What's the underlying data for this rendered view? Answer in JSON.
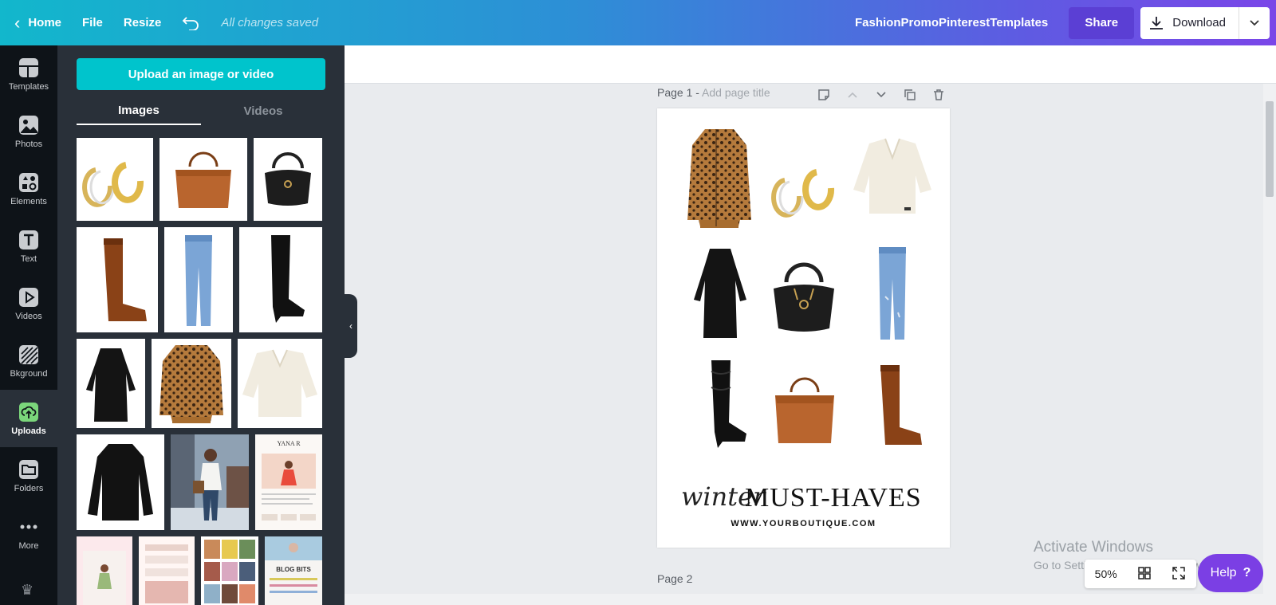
{
  "topbar": {
    "home": "Home",
    "file": "File",
    "resize": "Resize",
    "saved_status": "All changes saved",
    "doc_title": "FashionPromoPinterestTemplates",
    "share": "Share",
    "download": "Download"
  },
  "rail": {
    "items": [
      {
        "label": "Templates",
        "icon": "templates-icon"
      },
      {
        "label": "Photos",
        "icon": "photos-icon"
      },
      {
        "label": "Elements",
        "icon": "elements-icon"
      },
      {
        "label": "Text",
        "icon": "text-icon"
      },
      {
        "label": "Videos",
        "icon": "videos-icon"
      },
      {
        "label": "Bkground",
        "icon": "background-icon"
      },
      {
        "label": "Uploads",
        "icon": "uploads-icon",
        "active": true
      },
      {
        "label": "Folders",
        "icon": "folders-icon"
      },
      {
        "label": "More",
        "icon": "more-icon"
      }
    ]
  },
  "panel": {
    "upload_button": "Upload an image or video",
    "tabs": [
      {
        "label": "Images",
        "active": true
      },
      {
        "label": "Videos",
        "active": false
      }
    ],
    "thumbnail_subjects": [
      "gold hoop earrings",
      "tan leather tote",
      "black leather handbag",
      "brown tall boot",
      "light blue jeans",
      "black slouch boot",
      "black tunic dress",
      "leopard cardigan",
      "cream sweater",
      "black blouse",
      "street style photo",
      "blog template",
      "blog template",
      "blog template",
      "collage template",
      "blog template"
    ],
    "template_text": {
      "yana": "YANA R",
      "blog_bits": "BLOG BITS"
    }
  },
  "canvas": {
    "page1_label": "Page 1 - ",
    "page1_placeholder": "Add page title",
    "page2_label": "Page 2",
    "design": {
      "script_word": "winter",
      "headline": "MUST-HAVES",
      "url": "WWW.YOURBOUTIQUE.COM",
      "item_subjects": [
        "leopard cardigan",
        "gold hoop earrings",
        "cream sweater",
        "black tunic dress",
        "black leather handbag",
        "light blue jeans",
        "black slouch boot",
        "tan leather tote",
        "brown tall boot"
      ]
    }
  },
  "status": {
    "zoom": "50%",
    "help": "Help",
    "watermark_title": "Activate Windows",
    "watermark_sub": "Go to Settings to activate Windows."
  },
  "colors": {
    "accent_teal": "#00c4cc",
    "accent_purple": "#7b3fe4",
    "rail_bg": "#0e1318",
    "panel_bg": "#293039"
  }
}
